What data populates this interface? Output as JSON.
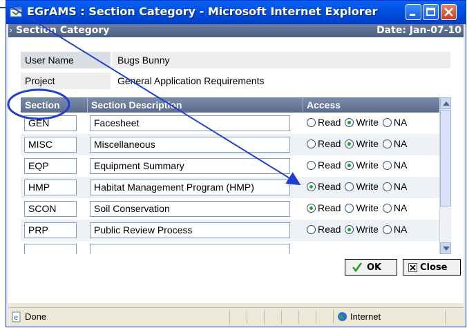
{
  "window": {
    "title": "EGrAMS : Section Category - Microsoft Internet Explorer"
  },
  "header": {
    "title": "Section Category",
    "date": "Date: Jan-07-10"
  },
  "info": {
    "user_label": "User Name",
    "user_value": "Bugs Bunny",
    "project_label": "Project",
    "project_value": "General Application Requirements"
  },
  "grid": {
    "columns": [
      "Section",
      "Section Description",
      "Access"
    ],
    "options": [
      "Read",
      "Write",
      "NA"
    ],
    "rows": [
      {
        "code": "GEN",
        "desc": "Facesheet",
        "access": "Write"
      },
      {
        "code": "MISC",
        "desc": "Miscellaneous",
        "access": "Write"
      },
      {
        "code": "EQP",
        "desc": "Equipment Summary",
        "access": "Write"
      },
      {
        "code": "HMP",
        "desc": "Habitat Management Program (HMP)",
        "access": "Read"
      },
      {
        "code": "SCON",
        "desc": "Soil Conservation",
        "access": "Read"
      },
      {
        "code": "PRP",
        "desc": "Public Review Process",
        "access": "Write"
      }
    ]
  },
  "buttons": {
    "ok": "OK",
    "close": "Close"
  },
  "status": {
    "left": "Done",
    "zone": "Internet"
  },
  "colors": {
    "annotation": "#1f3fcf",
    "selected_radio": "#21a121"
  }
}
